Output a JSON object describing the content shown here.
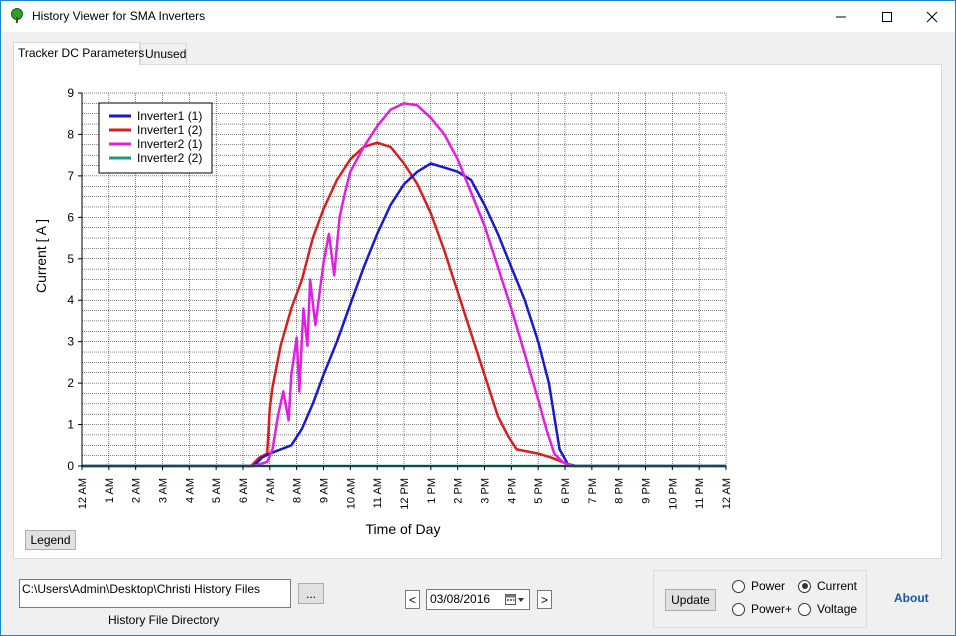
{
  "window": {
    "title": "History Viewer for SMA Inverters",
    "icon": "tree-icon",
    "controls": {
      "minimize": "minimize-icon",
      "maximize": "maximize-icon",
      "close": "close-icon"
    }
  },
  "tabs": [
    {
      "label": "Tracker DC Parameters",
      "active": true
    },
    {
      "label": "Unused",
      "active": false
    }
  ],
  "legend_button": "Legend",
  "directory": {
    "value": "C:\\Users\\Admin\\Desktop\\Christi History Files",
    "browse_label": "...",
    "caption": "History File Directory"
  },
  "date": {
    "prev_label": "<",
    "value": "03/08/2016",
    "next_label": ">",
    "calendar_icon": "calendar-icon"
  },
  "update_button": "Update",
  "mode": {
    "options": [
      {
        "label": "Power",
        "checked": false
      },
      {
        "label": "Current",
        "checked": true
      },
      {
        "label": "Power+",
        "checked": false
      },
      {
        "label": "Voltage",
        "checked": false
      }
    ]
  },
  "about_link": "About",
  "chart_data": {
    "type": "line",
    "xlabel": "Time of Day",
    "ylabel": "Current [ A ]",
    "xlim": [
      0,
      24
    ],
    "ylim": [
      0,
      9
    ],
    "x_ticks": [
      "12 AM",
      "1 AM",
      "2 AM",
      "3 AM",
      "4 AM",
      "5 AM",
      "6 AM",
      "7 AM",
      "8 AM",
      "9 AM",
      "10 AM",
      "11 AM",
      "12 PM",
      "1 PM",
      "2 PM",
      "3 PM",
      "4 PM",
      "5 PM",
      "6 PM",
      "7 PM",
      "8 PM",
      "9 PM",
      "10 PM",
      "11 PM",
      "12 AM"
    ],
    "y_ticks": [
      "0",
      "1",
      "2",
      "3",
      "4",
      "5",
      "6",
      "7",
      "8",
      "9"
    ],
    "grid": true,
    "legend_position": "top-left",
    "series": [
      {
        "name": "Inverter1 (1)",
        "color": "#1a1acc",
        "x": [
          0,
          6.4,
          6.7,
          7.0,
          7.4,
          7.8,
          8.2,
          8.6,
          9.0,
          9.5,
          10.0,
          10.5,
          11.0,
          11.5,
          12.0,
          12.5,
          13.0,
          13.5,
          14.0,
          14.5,
          15.0,
          15.5,
          16.0,
          16.5,
          17.0,
          17.4,
          17.8,
          18.1,
          18.4,
          24
        ],
        "y": [
          0,
          0,
          0.2,
          0.3,
          0.4,
          0.5,
          0.9,
          1.5,
          2.2,
          3.0,
          3.9,
          4.8,
          5.6,
          6.3,
          6.8,
          7.1,
          7.3,
          7.2,
          7.1,
          6.9,
          6.3,
          5.6,
          4.8,
          4.0,
          3.0,
          2.0,
          0.4,
          0.05,
          0,
          0
        ]
      },
      {
        "name": "Inverter1 (2)",
        "color": "#d42020",
        "x": [
          0,
          6.3,
          6.6,
          6.9,
          7.0,
          7.1,
          7.4,
          7.8,
          8.2,
          8.6,
          9.0,
          9.5,
          10.0,
          10.5,
          11.0,
          11.5,
          12.0,
          12.5,
          13.0,
          13.5,
          14.0,
          14.5,
          15.0,
          15.5,
          15.9,
          16.2,
          16.6,
          17.0,
          17.5,
          17.9,
          18.2,
          24
        ],
        "y": [
          0,
          0,
          0.2,
          0.3,
          1.4,
          1.9,
          2.9,
          3.8,
          4.5,
          5.5,
          6.2,
          6.9,
          7.4,
          7.7,
          7.8,
          7.7,
          7.3,
          6.8,
          6.1,
          5.2,
          4.2,
          3.2,
          2.2,
          1.2,
          0.7,
          0.4,
          0.35,
          0.3,
          0.2,
          0.1,
          0,
          0
        ]
      },
      {
        "name": "Inverter2 (1)",
        "color": "#e020e0",
        "x": [
          0,
          6.4,
          6.9,
          7.1,
          7.3,
          7.5,
          7.7,
          7.8,
          8.0,
          8.1,
          8.25,
          8.4,
          8.5,
          8.7,
          9.0,
          9.2,
          9.4,
          9.6,
          9.8,
          10.0,
          10.5,
          11.0,
          11.5,
          12.0,
          12.5,
          13.0,
          13.5,
          14.0,
          14.5,
          15.0,
          15.5,
          16.0,
          16.5,
          17.0,
          17.3,
          17.6,
          17.9,
          18.3,
          24
        ],
        "y": [
          0,
          0,
          0.1,
          0.4,
          1.2,
          1.8,
          1.1,
          2.2,
          3.1,
          1.8,
          3.8,
          2.9,
          4.5,
          3.4,
          4.9,
          5.6,
          4.6,
          6.0,
          6.6,
          7.1,
          7.7,
          8.2,
          8.6,
          8.75,
          8.7,
          8.4,
          8.0,
          7.4,
          6.6,
          5.8,
          4.8,
          3.8,
          2.7,
          1.6,
          0.9,
          0.3,
          0.1,
          0,
          0
        ]
      },
      {
        "name": "Inverter2 (2)",
        "color": "#1a9a8a",
        "x": [
          0,
          24
        ],
        "y": [
          0,
          0
        ]
      }
    ]
  }
}
